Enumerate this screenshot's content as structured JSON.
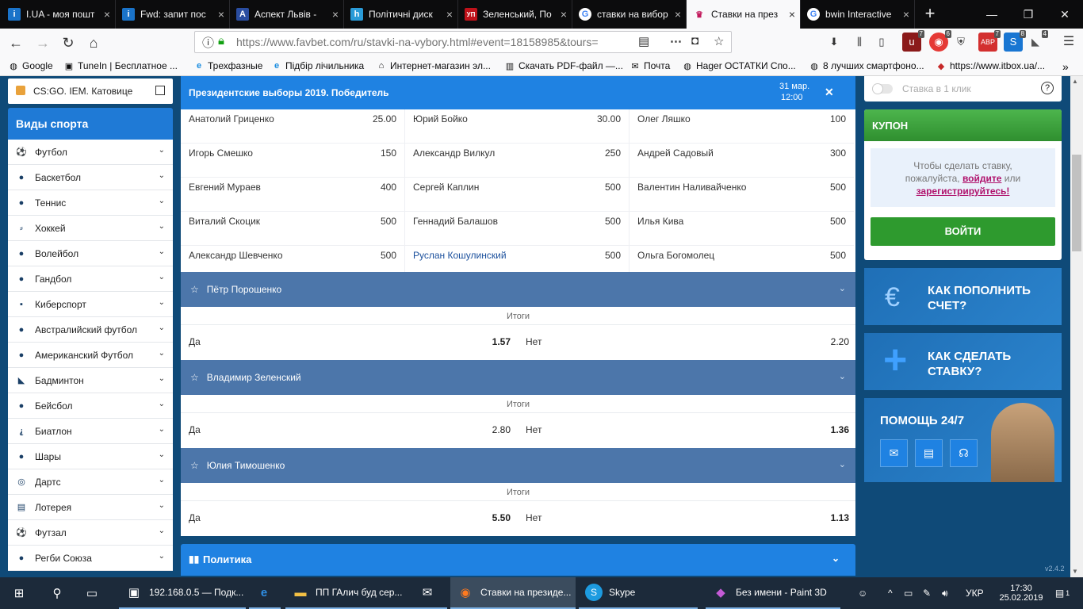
{
  "browser": {
    "tabs": [
      {
        "title": "I.UA - моя пошт",
        "icon": "iua-icon",
        "color": "#1a73c9"
      },
      {
        "title": "Fwd: запит пос",
        "icon": "iua-icon",
        "color": "#1a73c9"
      },
      {
        "title": "Аспект Львів -",
        "icon": "aspect-icon",
        "color": "#2a4da0"
      },
      {
        "title": "Політичні диск",
        "icon": "h-icon",
        "color": "#2a9bd8"
      },
      {
        "title": "Зеленський, По",
        "icon": "up-icon",
        "color": "#c0121a"
      },
      {
        "title": "ставки на вибор",
        "icon": "google-icon",
        "color": "#ffffff"
      },
      {
        "title": "Ставки на през",
        "icon": "favbet-icon",
        "color": "#c2185b",
        "active": true
      },
      {
        "title": "bwin Interactive",
        "icon": "google-icon",
        "color": "#ffffff"
      }
    ],
    "url": "https://www.favbet.com/ru/stavki-na-vybory.html#event=18158985&tours=",
    "bookmarks": [
      {
        "label": "Google",
        "icon": "globe-icon"
      },
      {
        "label": "TuneIn | Бесплатное ...",
        "icon": "tunein-icon"
      },
      {
        "label": "Трехфазные",
        "icon": "ie-icon"
      },
      {
        "label": "Підбір лічильника",
        "icon": "ie-icon"
      },
      {
        "label": "Интернет-магазин эл...",
        "icon": "house-icon"
      },
      {
        "label": "Скачать PDF-файл —...",
        "icon": "pdf-icon"
      },
      {
        "label": "Почта",
        "icon": "mail-icon"
      },
      {
        "label": "Hager ОСТАТКИ Спо...",
        "icon": "globe-icon"
      },
      {
        "label": "8 лучших смартфоно...",
        "icon": "globe-icon"
      },
      {
        "label": "https://www.itbox.ua/...",
        "icon": "itbox-icon"
      }
    ],
    "toolbar_badges": [
      "7",
      "6",
      "7",
      "8",
      "4"
    ]
  },
  "sidebar": {
    "top_item": "CS:GO. IEM. Катовице",
    "header": "Виды спорта",
    "sports": [
      {
        "label": "Футбол",
        "icon": "football-icon"
      },
      {
        "label": "Баскетбол",
        "icon": "basketball-icon"
      },
      {
        "label": "Теннис",
        "icon": "tennis-icon"
      },
      {
        "label": "Хоккей",
        "icon": "hockey-icon"
      },
      {
        "label": "Волейбол",
        "icon": "volleyball-icon"
      },
      {
        "label": "Гандбол",
        "icon": "handball-icon"
      },
      {
        "label": "Киберспорт",
        "icon": "esports-icon"
      },
      {
        "label": "Австралийский футбол",
        "icon": "aussie-football-icon"
      },
      {
        "label": "Американский Футбол",
        "icon": "american-football-icon"
      },
      {
        "label": "Бадминтон",
        "icon": "badminton-icon"
      },
      {
        "label": "Бейсбол",
        "icon": "baseball-icon"
      },
      {
        "label": "Биатлон",
        "icon": "biathlon-icon"
      },
      {
        "label": "Шары",
        "icon": "balls-icon"
      },
      {
        "label": "Дартс",
        "icon": "darts-icon"
      },
      {
        "label": "Лотерея",
        "icon": "lottery-icon"
      },
      {
        "label": "Футзал",
        "icon": "futsal-icon"
      },
      {
        "label": "Регби Союза",
        "icon": "rugby-icon"
      }
    ]
  },
  "market": {
    "title": "Президентские выборы 2019. Победитель",
    "date": "31 мар.",
    "time": "12:00",
    "odds": [
      [
        {
          "name": "Анатолий Гриценко",
          "odd": "25.00"
        },
        {
          "name": "Юрий Бойко",
          "odd": "30.00"
        },
        {
          "name": "Олег Ляшко",
          "odd": "100"
        }
      ],
      [
        {
          "name": "Игорь Смешко",
          "odd": "150"
        },
        {
          "name": "Александр Вилкул",
          "odd": "250"
        },
        {
          "name": "Андрей Садовый",
          "odd": "300"
        }
      ],
      [
        {
          "name": "Евгений Мураев",
          "odd": "400"
        },
        {
          "name": "Сергей Каплин",
          "odd": "500"
        },
        {
          "name": "Валентин Наливайченко",
          "odd": "500"
        }
      ],
      [
        {
          "name": "Виталий Скоцик",
          "odd": "500"
        },
        {
          "name": "Геннадий Балашов",
          "odd": "500"
        },
        {
          "name": "Илья Кива",
          "odd": "500"
        }
      ],
      [
        {
          "name": "Александр Шевченко",
          "odd": "500"
        },
        {
          "name": "Руслан Кошулинский",
          "odd": "500",
          "highlight": true
        },
        {
          "name": "Ольга Богомолец",
          "odd": "500"
        }
      ]
    ],
    "candidates": [
      {
        "name": "Пётр Порошенко",
        "section": "Итоги",
        "yes_label": "Да",
        "yes": "1.57",
        "no_label": "Нет",
        "no": "2.20"
      },
      {
        "name": "Владимир Зеленский",
        "section": "Итоги",
        "yes_label": "Да",
        "yes": "2.80",
        "no_label": "Нет",
        "no": "1.36"
      },
      {
        "name": "Юлия Тимошенко",
        "section": "Итоги",
        "yes_label": "Да",
        "yes": "5.50",
        "no_label": "Нет",
        "no": "1.13"
      }
    ],
    "politics": "Политика"
  },
  "right": {
    "oneclick": "Ставка в 1 клик",
    "coupon_title": "КУПОН",
    "coupon_text1": "Чтобы сделать ставку,",
    "coupon_text2": "пожалуйста,",
    "coupon_login_link": "войдите",
    "coupon_or": "или",
    "coupon_register_link": "зарегистрируйтесь!",
    "login_button": "ВОЙТИ",
    "promo1_line1": "КАК ПОПОЛНИТЬ",
    "promo1_line2": "СЧЕТ?",
    "promo2_line1": "КАК СДЕЛАТЬ",
    "promo2_line2": "СТАВКУ?",
    "help_title": "ПОМОЩЬ 24/7",
    "version": "v2.4.2"
  },
  "taskbar": {
    "items": [
      {
        "label": "192.168.0.5 — Подк...",
        "icon": "remote-icon"
      },
      {
        "label": "",
        "icon": "edge-icon"
      },
      {
        "label": "ПП ГАлич буд сер...",
        "icon": "folder-icon"
      },
      {
        "label": "",
        "icon": "mail-icon"
      },
      {
        "label": "Ставки на президе...",
        "icon": "firefox-icon",
        "active": true
      },
      {
        "label": "Skype",
        "icon": "skype-icon"
      },
      {
        "label": "Без имени - Paint 3D",
        "icon": "paint3d-icon"
      }
    ],
    "lang": "УКР",
    "time": "17:30",
    "date": "25.02.2019",
    "notifications": "1"
  }
}
